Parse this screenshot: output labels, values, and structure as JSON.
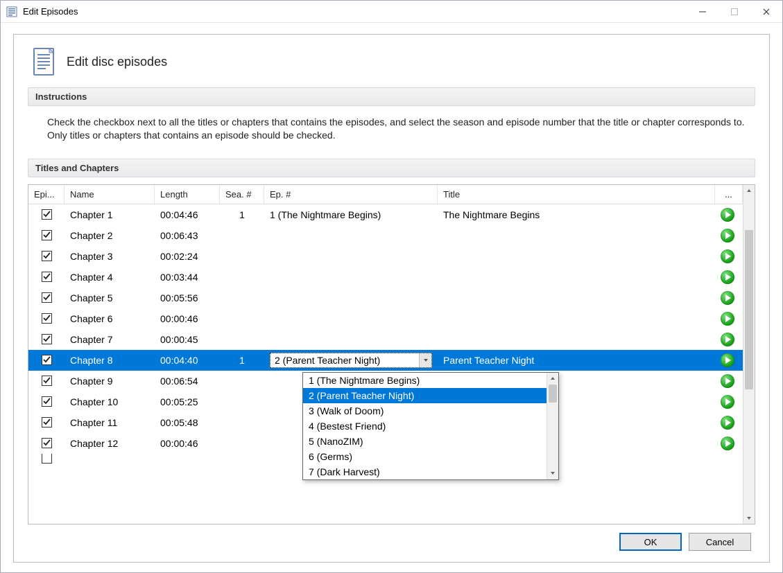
{
  "window": {
    "title": "Edit Episodes"
  },
  "header": {
    "title": "Edit disc episodes"
  },
  "sections": {
    "instructions_label": "Instructions",
    "instructions_text": "Check the checkbox next to all the titles or chapters that contains the episodes, and select the season and episode number that the title or chapter corresponds to. Only titles or chapters that contains an episode should be checked.",
    "titles_label": "Titles and Chapters"
  },
  "columns": {
    "epi": "Epi...",
    "name": "Name",
    "length": "Length",
    "sea": "Sea. #",
    "ep": "Ep. #",
    "title": "Title",
    "play": "..."
  },
  "rows": [
    {
      "checked": true,
      "name": "Chapter 1",
      "length": "00:04:46",
      "sea": "1",
      "ep": "1 (The Nightmare Begins)",
      "title": "The Nightmare Begins",
      "selected": false,
      "combo": false
    },
    {
      "checked": true,
      "name": "Chapter 2",
      "length": "00:06:43",
      "sea": "",
      "ep": "",
      "title": "",
      "selected": false,
      "combo": false
    },
    {
      "checked": true,
      "name": "Chapter 3",
      "length": "00:02:24",
      "sea": "",
      "ep": "",
      "title": "",
      "selected": false,
      "combo": false
    },
    {
      "checked": true,
      "name": "Chapter 4",
      "length": "00:03:44",
      "sea": "",
      "ep": "",
      "title": "",
      "selected": false,
      "combo": false
    },
    {
      "checked": true,
      "name": "Chapter 5",
      "length": "00:05:56",
      "sea": "",
      "ep": "",
      "title": "",
      "selected": false,
      "combo": false
    },
    {
      "checked": true,
      "name": "Chapter 6",
      "length": "00:00:46",
      "sea": "",
      "ep": "",
      "title": "",
      "selected": false,
      "combo": false
    },
    {
      "checked": true,
      "name": "Chapter 7",
      "length": "00:00:45",
      "sea": "",
      "ep": "",
      "title": "",
      "selected": false,
      "combo": false
    },
    {
      "checked": true,
      "name": "Chapter 8",
      "length": "00:04:40",
      "sea": "1",
      "ep": "2 (Parent Teacher Night)",
      "title": "Parent Teacher Night",
      "selected": true,
      "combo": true
    },
    {
      "checked": true,
      "name": "Chapter 9",
      "length": "00:06:54",
      "sea": "",
      "ep": "",
      "title": "",
      "selected": false,
      "combo": false
    },
    {
      "checked": true,
      "name": "Chapter 10",
      "length": "00:05:25",
      "sea": "",
      "ep": "",
      "title": "",
      "selected": false,
      "combo": false
    },
    {
      "checked": true,
      "name": "Chapter 11",
      "length": "00:05:48",
      "sea": "",
      "ep": "",
      "title": "",
      "selected": false,
      "combo": false
    },
    {
      "checked": true,
      "name": "Chapter 12",
      "length": "00:00:46",
      "sea": "",
      "ep": "",
      "title": "",
      "selected": false,
      "combo": false
    }
  ],
  "dropdown": {
    "highlight_index": 1,
    "options": [
      "1 (The Nightmare Begins)",
      "2 (Parent Teacher Night)",
      "3 (Walk of Doom)",
      "4 (Bestest Friend)",
      "5 (NanoZIM)",
      "6 (Germs)",
      "7 (Dark Harvest)"
    ]
  },
  "footer": {
    "ok": "OK",
    "cancel": "Cancel"
  }
}
